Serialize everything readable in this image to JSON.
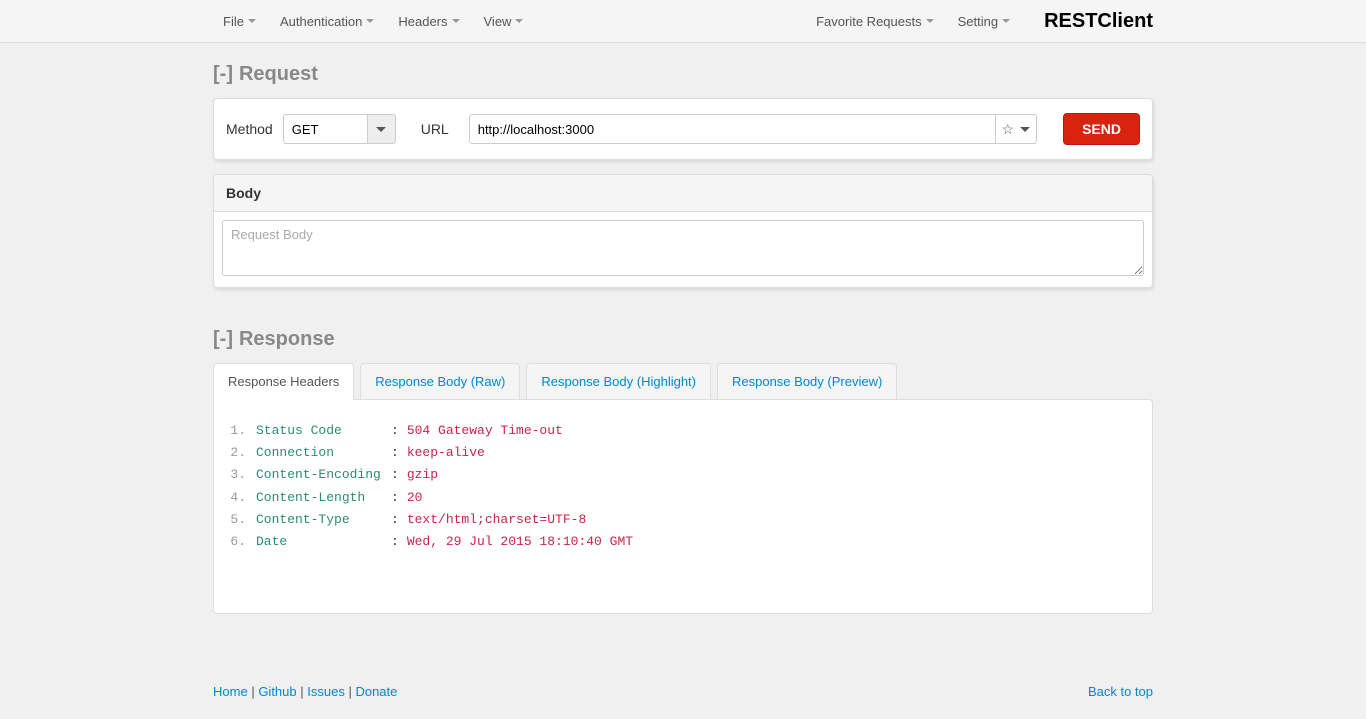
{
  "topbar": {
    "menus_left": [
      "File",
      "Authentication",
      "Headers",
      "View"
    ],
    "menus_right": [
      "Favorite Requests",
      "Setting"
    ],
    "brand": "RESTClient"
  },
  "request": {
    "title": "Request",
    "collapse": "[-]",
    "method_label": "Method",
    "method_value": "GET",
    "url_label": "URL",
    "url_value": "http://localhost:3000",
    "send_label": "SEND",
    "body_title": "Body",
    "body_placeholder": "Request Body"
  },
  "response": {
    "title": "Response",
    "collapse": "[-]",
    "tabs": [
      "Response Headers",
      "Response Body (Raw)",
      "Response Body (Highlight)",
      "Response Body (Preview)"
    ],
    "headers": [
      {
        "n": "1",
        "key": "Status Code",
        "value": "504 Gateway Time-out"
      },
      {
        "n": "2",
        "key": "Connection",
        "value": "keep-alive"
      },
      {
        "n": "3",
        "key": "Content-Encoding",
        "value": "gzip"
      },
      {
        "n": "4",
        "key": "Content-Length",
        "value": "20"
      },
      {
        "n": "5",
        "key": "Content-Type",
        "value": "text/html;charset=UTF-8"
      },
      {
        "n": "6",
        "key": "Date",
        "value": "Wed, 29 Jul 2015 18:10:40 GMT"
      }
    ]
  },
  "footer": {
    "links": [
      "Home",
      "Github",
      "Issues",
      "Donate"
    ],
    "back": "Back to top"
  }
}
